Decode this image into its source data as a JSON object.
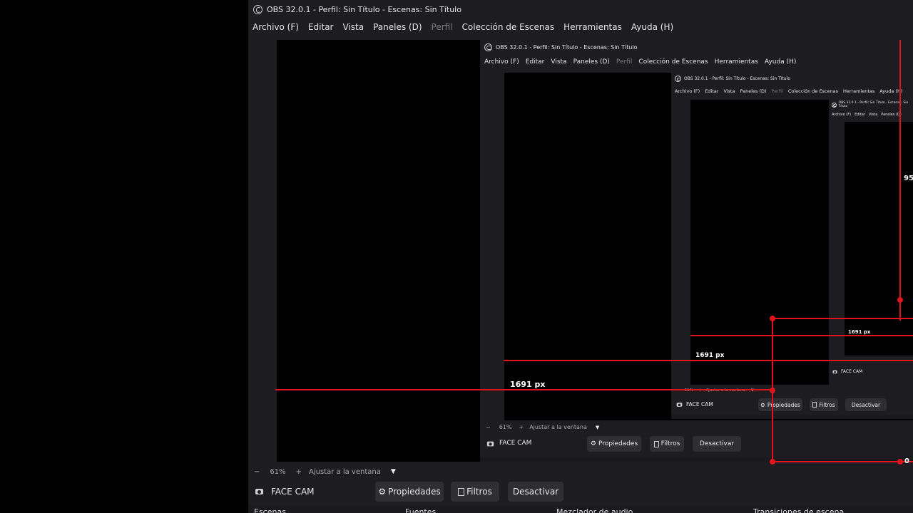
{
  "window": {
    "title": "OBS 32.0.1 - Perfil: Sin Título - Escenas: Sin Título",
    "menu": [
      "Archivo (F)",
      "Editar",
      "Vista",
      "Paneles (D)",
      "Perfil",
      "Colección de Escenas",
      "Herramientas",
      "Ayuda (H)"
    ],
    "disabled_menu": "Perfil"
  },
  "zoom": {
    "minus": "−",
    "value": "61%",
    "plus": "+",
    "fit": "Ajustar a la ventana",
    "dropdown": "▼"
  },
  "context": {
    "source_name": "FACE CAM",
    "properties": "Propiedades",
    "filters": "Filtros",
    "deactivate": "Desactivar"
  },
  "measurements": {
    "width_label": "1691 px",
    "height_label_partial": "95",
    "zero_label_partial": "0"
  },
  "docks": [
    "Escenas",
    "Fuentes",
    "Mezclador de audio",
    "Transiciones de escena"
  ],
  "colors": {
    "guide_red": "#e0141c",
    "window_bg": "#1d1d21",
    "button_bg": "#2e2e33"
  }
}
